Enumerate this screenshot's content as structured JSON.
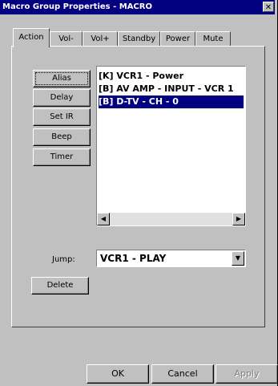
{
  "window": {
    "title": "Macro Group Properties - MACRO",
    "close_glyph": "✕"
  },
  "tabs": [
    {
      "label": "Action",
      "active": true
    },
    {
      "label": "Vol-",
      "active": false
    },
    {
      "label": "Vol+",
      "active": false
    },
    {
      "label": "Standby",
      "active": false
    },
    {
      "label": "Power",
      "active": false
    },
    {
      "label": "Mute",
      "active": false
    }
  ],
  "action_buttons": {
    "alias": "Alias",
    "delay": "Delay",
    "set_ir": "Set IR",
    "beep": "Beep",
    "timer": "Timer"
  },
  "macro_list": {
    "items": [
      {
        "text": "[K] VCR1 - Power",
        "selected": false
      },
      {
        "text": "[B] AV AMP - INPUT - VCR 1",
        "selected": false
      },
      {
        "text": "[B] D-TV - CH - 0",
        "selected": true
      }
    ],
    "scroll_left": "◀",
    "scroll_right": "▶"
  },
  "jump": {
    "label": "Jump:",
    "value": "VCR1 - PLAY",
    "arrow": "▼"
  },
  "delete_button": "Delete",
  "dialog_buttons": {
    "ok": "OK",
    "cancel": "Cancel",
    "apply": "Apply"
  },
  "colors": {
    "face": "#c0c0c0",
    "selection": "#000080",
    "titlebar": "#000080"
  }
}
